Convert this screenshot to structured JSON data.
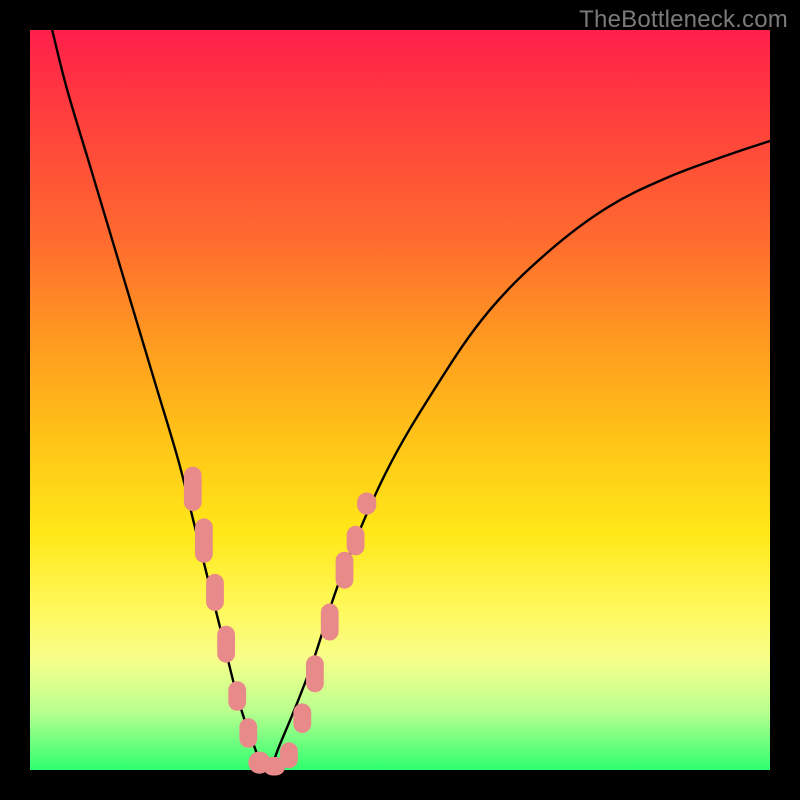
{
  "watermark": {
    "text": "TheBottleneck.com"
  },
  "chart_data": {
    "type": "line",
    "title": "",
    "xlabel": "",
    "ylabel": "",
    "xlim": [
      0,
      100
    ],
    "ylim": [
      0,
      100
    ],
    "legend": false,
    "grid": false,
    "background_gradient": {
      "direction": "vertical",
      "stops": [
        {
          "pos": 0.0,
          "color": "#ff1f4b"
        },
        {
          "pos": 0.28,
          "color": "#ff6a2f"
        },
        {
          "pos": 0.55,
          "color": "#ffc317"
        },
        {
          "pos": 0.78,
          "color": "#fff85a"
        },
        {
          "pos": 0.92,
          "color": "#baff8f"
        },
        {
          "pos": 1.0,
          "color": "#2dff6f"
        }
      ]
    },
    "series": [
      {
        "name": "bottleneck-curve",
        "color": "#000000",
        "x": [
          3,
          5,
          8,
          11,
          14,
          17,
          20,
          22,
          24,
          26,
          28,
          30,
          32,
          34,
          38,
          42,
          48,
          55,
          62,
          70,
          78,
          86,
          94,
          100
        ],
        "y": [
          100,
          92,
          82,
          72,
          62,
          52,
          42,
          34,
          26,
          18,
          10,
          4,
          0,
          4,
          14,
          26,
          40,
          52,
          62,
          70,
          76,
          80,
          83,
          85
        ]
      }
    ],
    "markers": [
      {
        "name": "cluster-dots",
        "color": "#e98a8a",
        "shape": "round-rect",
        "points": [
          {
            "x": 22,
            "y": 38,
            "w": 2.4,
            "h": 6
          },
          {
            "x": 23.5,
            "y": 31,
            "w": 2.4,
            "h": 6
          },
          {
            "x": 25,
            "y": 24,
            "w": 2.4,
            "h": 5
          },
          {
            "x": 26.5,
            "y": 17,
            "w": 2.4,
            "h": 5
          },
          {
            "x": 28,
            "y": 10,
            "w": 2.4,
            "h": 4
          },
          {
            "x": 29.5,
            "y": 5,
            "w": 2.4,
            "h": 4
          },
          {
            "x": 31,
            "y": 1,
            "w": 3,
            "h": 3
          },
          {
            "x": 33,
            "y": 0.5,
            "w": 3,
            "h": 2.5
          },
          {
            "x": 35,
            "y": 2,
            "w": 2.4,
            "h": 3.5
          },
          {
            "x": 36.8,
            "y": 7,
            "w": 2.4,
            "h": 4
          },
          {
            "x": 38.5,
            "y": 13,
            "w": 2.4,
            "h": 5
          },
          {
            "x": 40.5,
            "y": 20,
            "w": 2.4,
            "h": 5
          },
          {
            "x": 42.5,
            "y": 27,
            "w": 2.4,
            "h": 5
          },
          {
            "x": 45.5,
            "y": 36,
            "w": 2.6,
            "h": 3
          },
          {
            "x": 44,
            "y": 31,
            "w": 2.4,
            "h": 4
          }
        ]
      }
    ]
  }
}
